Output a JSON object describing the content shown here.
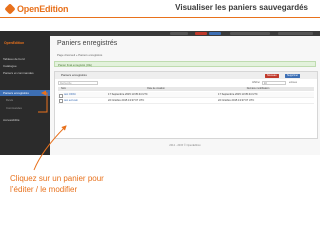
{
  "brand": {
    "name": "OpenEdition"
  },
  "slide": {
    "title": "Visualiser les paniers sauvegardés",
    "caption_line1": "Cliquez sur un panier pour",
    "caption_line2": "l’éditer / le modifier"
  },
  "app": {
    "logo": "OpenEdition",
    "sidebar": [
      {
        "label": "Tableau de bord"
      },
      {
        "label": "Catalogue"
      },
      {
        "label": "Paniers et commandes"
      },
      {
        "label": "Paniers enregistrés",
        "active": true
      },
      {
        "label": "Devis"
      },
      {
        "label": "Commandes"
      },
      {
        "label": "Accessibilité"
      }
    ],
    "page_title": "Paniers enregistrés",
    "breadcrumb": "Page d'accueil » Paniers enregistrés",
    "alert": "Panier final enregistré (OE)",
    "panel_title": "Paniers enregistrés",
    "buttons": {
      "new": "Nouveau",
      "delete": "Supprimer"
    },
    "search_placeholder": "Recherche",
    "show_label": "Afficher",
    "show_value": "10",
    "per_page_label": "entrées",
    "table": {
      "headers": [
        "Nom",
        "Date de création",
        "Dernière modification"
      ],
      "rows": [
        {
          "name": "test OPAC",
          "created": "17 Septembre 2015 13:35:44 UTC",
          "modified": "17 Septembre 2015 13:35:44 UTC"
        },
        {
          "name": "test ecrivain",
          "created": "22 Octobre 2015 13:37:07 UTC",
          "modified": "22 Octobre 2015 13:37:07 UTC"
        }
      ]
    },
    "footer": "2012 - 2015 © OpenEdition"
  },
  "colors": {
    "accent": "#e8711c",
    "link": "#3d6fb4",
    "sidebar": "#2b2b2b"
  }
}
